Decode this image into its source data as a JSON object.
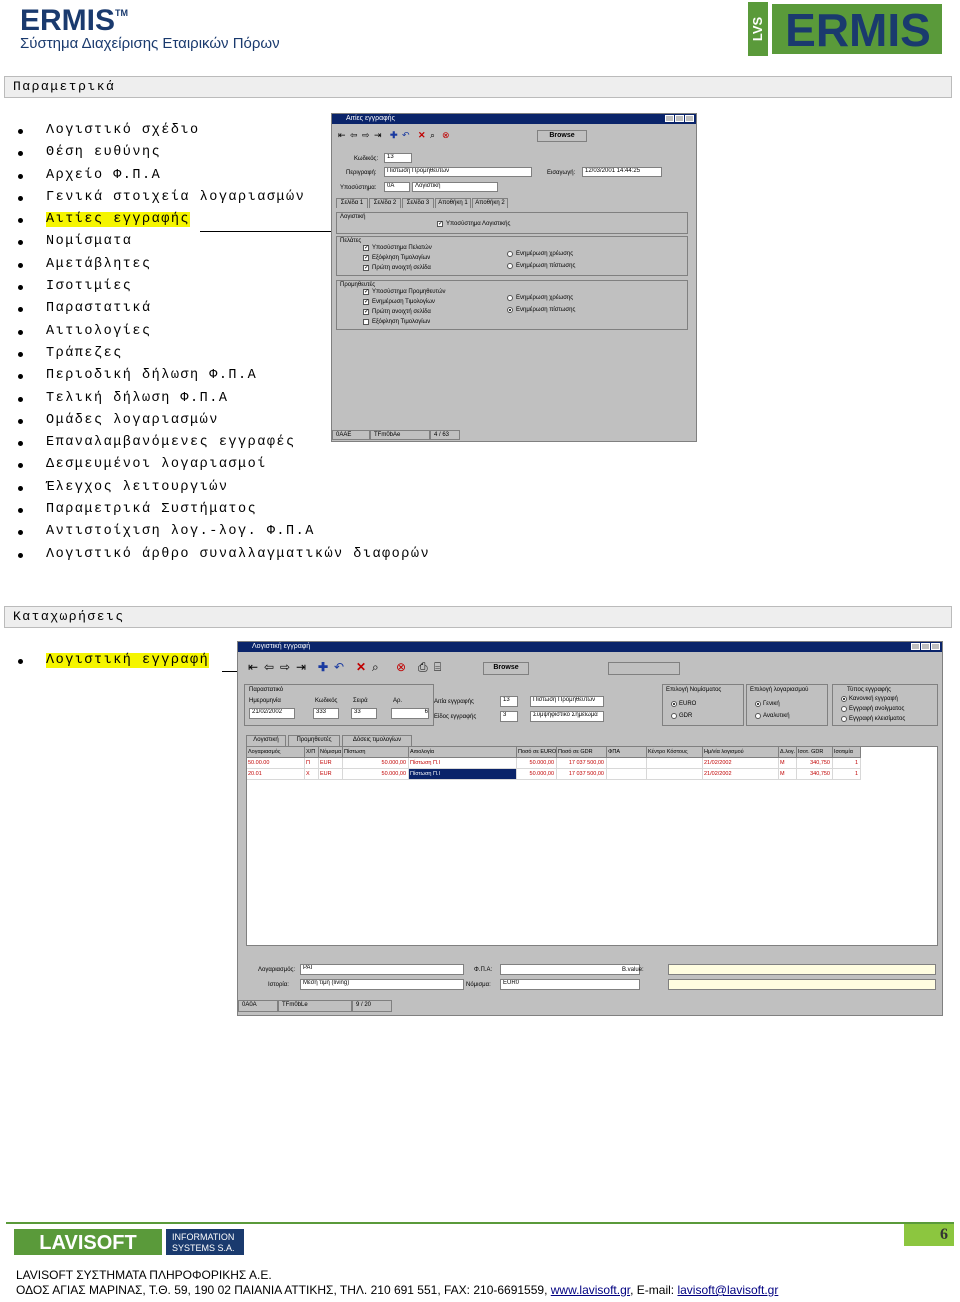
{
  "header": {
    "brand": "ERMIS",
    "tm": "TM",
    "subtitle": "Σύστημα Διαχείρισης Εταιρικών Πόρων",
    "logo_vertical": "LVS",
    "logo_text": "ERMIS"
  },
  "sections": {
    "parametrika": "Παραμετρικά",
    "kataxoriseis": "Καταχωρήσεις"
  },
  "menu_parametrika": [
    "Λογιστικό σχέδιο",
    "Θέση ευθύνης",
    "Αρχείο Φ.Π.Α",
    "Γενικά στοιχεία λογαριασμών",
    "Αιτίες εγγραφής",
    "Νομίσματα",
    "Αμετάβλητες",
    "Ισοτιμίες",
    "Παραστατικά",
    "Αιτιολογίες",
    "Τράπεζες",
    "Περιοδική δήλωση Φ.Π.Α",
    "Τελική δήλωση Φ.Π.Α",
    "Ομάδες λογαριασμών",
    "Επαναλαμβανόμενες εγγραφές",
    "Δεσμευμένοι λογαριασμοί",
    "Έλεγχος λειτουργιών",
    "Παραμετρικά Συστήματος",
    "Αντιστοίχιση λογ.-λογ. Φ.Π.Α",
    "Λογιστικό άρθρο συναλλαγματικών διαφορών"
  ],
  "menu_kataxoriseis": [
    "Λογιστική εγγραφή"
  ],
  "win1": {
    "title": "Αιτίες εγγραφής",
    "browse": "Browse",
    "kodikos_label": "Κωδικός:",
    "kodikos_value": "13",
    "perigrafi_label": "Περιγραφή:",
    "perigrafi_value": "Πίστωση Προμηθευτών",
    "eisagogi_label": "Εισαγωγή:",
    "eisagogi_value": "12/03/2001 14:44:25",
    "ypos_label": "Υποσύστημα:",
    "ypos_code": "0A",
    "ypos_value": "Λογιστική",
    "tabs": [
      "Σελίδα 1",
      "Σελίδα 2",
      "Σελίδα 3",
      "Αποθήκη 1",
      "Αποθήκη 2"
    ],
    "grp_logistiki": "Λογιστική",
    "chk_logistiki": "Υποσύστημα Λογιστικής",
    "grp_pelates": "Πελάτες",
    "pelates_checks": [
      "Υποσύστημα Πελατών",
      "Εξόφληση Τιμολογίων",
      "Πρώτη ανοιχτή σελίδα"
    ],
    "pelates_radios": [
      "Ενημέρωση χρέωσης",
      "Ενημέρωση πίστωσης"
    ],
    "grp_prom": "Προμηθευτές",
    "prom_checks": [
      "Υποσύστημα Προμηθευτών",
      "Ενημέρωση Τιμολογίων",
      "Πρώτη ανοιχτή σελίδα",
      "Εξόφληση Τιμολογίων"
    ],
    "prom_radios": [
      "Ενημέρωση χρέωσης",
      "Ενημέρωση πίστωσης"
    ],
    "status": [
      "0AAE",
      "TFm0bAe",
      "4 / 63"
    ]
  },
  "win2": {
    "title": "Λογιστική εγγραφή",
    "browse": "Browse",
    "group_label": "Παραστατικό",
    "date_label": "Ημερομηνία",
    "date_value": "21/02/2002",
    "kod_label": "Κωδικός",
    "kod_value": "333",
    "seira_label": "Σειρά",
    "seira_value": "33",
    "ar_label": "Αρ.",
    "ar_value": "6",
    "aitia_label": "Αιτία εγγραφής",
    "aitia_code": "13",
    "aitia_value": "Πίστωση Προμηθευτών",
    "eidos_label": "Είδος εγγραφής",
    "eidos_code": "3",
    "eidos_value": "Συμψηφιστικό Σημείωμα",
    "nomisma_label": "Επιλογή Νομίσματος",
    "nomisma_opts": [
      "EURO",
      "GDR"
    ],
    "logar_label": "Επιλογή λογαριασμού",
    "logar_opts": [
      "Γενική",
      "Αναλυτική"
    ],
    "typos_label": "Τύπος εγγραφής",
    "typos_opts": [
      "Κανονική εγγραφή",
      "Εγγραφή ανοίγματος",
      "Εγγραφή κλεισίματος"
    ],
    "tabs": [
      "Λογιστική",
      "Προμηθευτές",
      "Δόσεις τιμολογίων"
    ],
    "columns": [
      "Λογαριασμός",
      "Χ/Π",
      "Νόμισμα",
      "Πίστωση",
      "Αιτιολογία",
      "Ποσό σε EURO",
      "Ποσό σε GDR",
      "ΦΠΑ",
      "Κέντρο Κόστους",
      "Ημ/νία λογισμού",
      "Δ.λογ.",
      "Ισοτ. GDR",
      "Ισοτιμία"
    ],
    "rows": [
      [
        "50.00.00",
        "Π",
        "EUR",
        "50.000,00",
        "Πίστωση Π.Ι",
        "50.000,00",
        "17 037 500,00",
        "",
        "",
        "21/02/2002",
        "M",
        "340,750",
        "1"
      ],
      [
        "20.01",
        "X",
        "EUR",
        "50.000,00",
        "Πίστωση Π.Ι",
        "50.000,00",
        "17 037 500,00",
        "",
        "",
        "21/02/2002",
        "M",
        "340,750",
        "1"
      ]
    ],
    "logar_field_label": "Λογαριασμός:",
    "logar_field_value": "PAI",
    "fpa_label": "Φ.Π.Α:",
    "valuelist_label": "B.value:",
    "istoria_label": "Ιστορία:",
    "istoria_value": "Μέση τιμή (living)",
    "nomisma2_label": "Νόμισμα:",
    "nomisma2_value": "EUR0",
    "status": [
      "0A0A",
      "TFm0bLe",
      "9 / 20"
    ]
  },
  "footer": {
    "logo_main": "LAVISOFT",
    "logo_sub1": "INFORMATION",
    "logo_sub2": "SYSTEMS S.A.",
    "page": "6",
    "line1": "LAVISOFT ΣΥΣΤΗΜΑΤΑ ΠΛΗΡΟΦΟΡΙΚΗΣ Α.Ε.",
    "line2": "ΟΔΟΣ ΑΓΙΑΣ ΜΑΡΙΝΑΣ, Τ.Θ. 59, 190 02 ΠΑΙΑΝΙΑ ΑΤΤΙΚΗΣ, ΤΗΛ. 210 691 551, FAX: 210-6691559, ",
    "web": "www.lavisoft.gr",
    "email_label": ", E-mail: ",
    "email": "lavisoft@lavisoft.gr"
  },
  "colors": {
    "brand_blue": "#1a3a6e",
    "logo_green": "#5a9a3a",
    "highlight": "#f5f500",
    "titlebar": "#0a246a"
  }
}
